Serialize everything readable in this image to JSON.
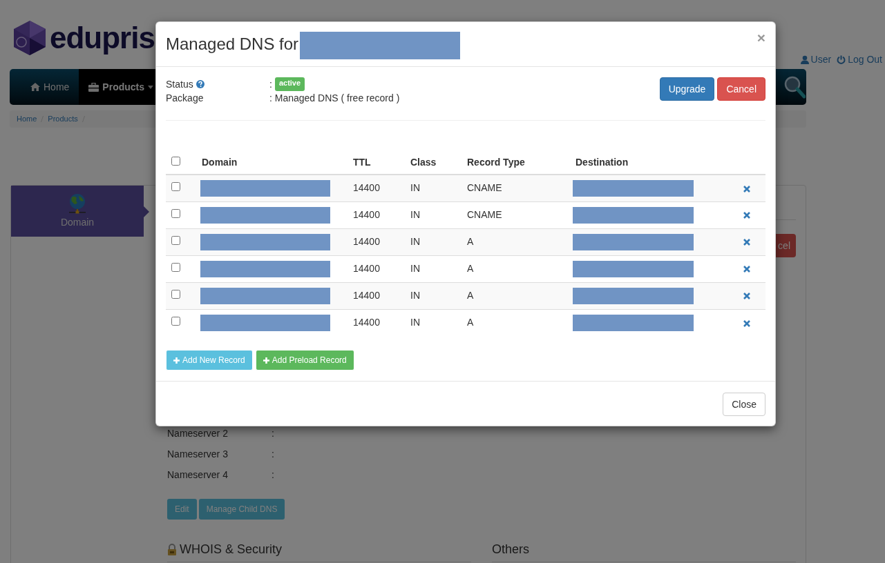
{
  "header": {
    "logo_text": "edupris",
    "links": [
      {
        "kind": "user",
        "label": "User"
      },
      {
        "kind": "logout",
        "label": "Log Out"
      }
    ]
  },
  "navbar": {
    "items": [
      {
        "kind": "home",
        "label": "Home",
        "selected": false,
        "dropdown": false
      },
      {
        "kind": "products",
        "label": "Products",
        "selected": true,
        "dropdown": true
      }
    ]
  },
  "breadcrumb": [
    "Home",
    "Products"
  ],
  "sidebar": {
    "items": [
      {
        "label": "Domain",
        "selected": true
      }
    ]
  },
  "panel": {
    "cancel_button": "cel",
    "nameservers": [
      {
        "label": "Nameserver 2",
        "separator": ":"
      },
      {
        "label": "Nameserver 3",
        "separator": ":"
      },
      {
        "label": "Nameserver 4",
        "separator": ":"
      }
    ],
    "buttons": [
      "Edit",
      "Manage Child DNS"
    ],
    "sections": [
      {
        "kind": "lock",
        "title": "WHOIS & Security"
      },
      {
        "kind": "plain",
        "title": "Others"
      }
    ]
  },
  "modal": {
    "title": "Managed DNS for",
    "title_redacted": true,
    "close": "×",
    "status": {
      "label": "Status",
      "separator": ":",
      "badge": "active"
    },
    "package": {
      "label": "Package",
      "value": ": Managed DNS ( free record )"
    },
    "actions": [
      {
        "kind": "primary",
        "label": "Upgrade"
      },
      {
        "kind": "danger",
        "label": "Cancel"
      }
    ],
    "table": {
      "all_checked": false,
      "columns": [
        "Domain",
        "TTL",
        "Class",
        "Record Type",
        "Destination"
      ],
      "rows": [
        {
          "checked": false,
          "domain_redacted": true,
          "ttl": "14400",
          "class": "IN",
          "type": "CNAME",
          "destination_redacted": true
        },
        {
          "checked": false,
          "domain_redacted": true,
          "ttl": "14400",
          "class": "IN",
          "type": "CNAME",
          "destination_redacted": true
        },
        {
          "checked": false,
          "domain_redacted": true,
          "ttl": "14400",
          "class": "IN",
          "type": "A",
          "destination_redacted": true
        },
        {
          "checked": false,
          "domain_redacted": true,
          "ttl": "14400",
          "class": "IN",
          "type": "A",
          "destination_redacted": true
        },
        {
          "checked": false,
          "domain_redacted": true,
          "ttl": "14400",
          "class": "IN",
          "type": "A",
          "destination_redacted": true
        },
        {
          "checked": false,
          "domain_redacted": true,
          "ttl": "14400",
          "class": "IN",
          "type": "A",
          "destination_redacted": true
        }
      ]
    },
    "add_buttons": [
      {
        "kind": "info",
        "label": "Add New Record"
      },
      {
        "kind": "success",
        "label": "Add Preload Record"
      }
    ],
    "footer_button": "Close"
  }
}
